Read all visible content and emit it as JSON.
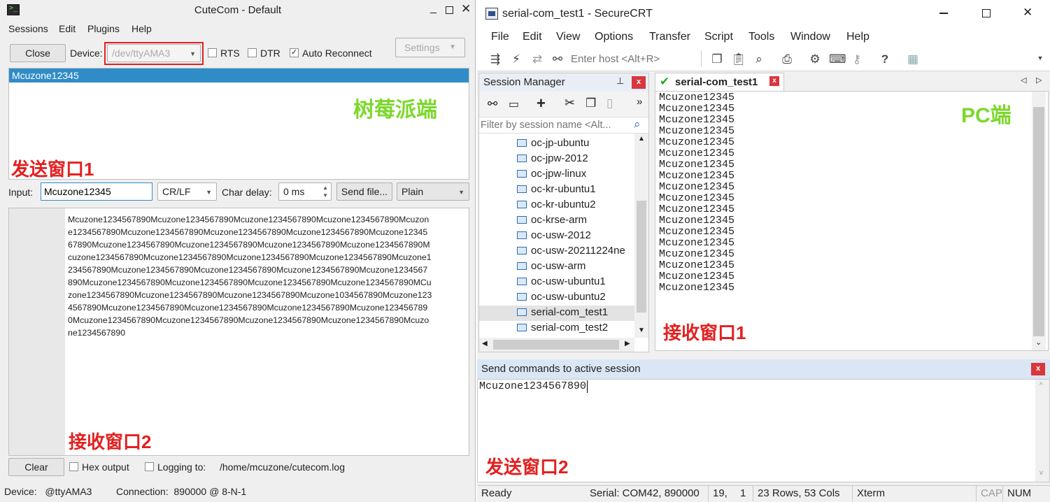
{
  "cutecom": {
    "title": "CuteCom - Default",
    "menu": [
      "Sessions",
      "Edit",
      "Plugins",
      "Help"
    ],
    "close_label": "Close",
    "device_label": "Device:",
    "device_value": "/dev/ttyAMA3",
    "rts_label": "RTS",
    "rts_checked": false,
    "dtr_label": "DTR",
    "dtr_checked": false,
    "auto_reconnect_label": "Auto Reconnect",
    "auto_reconnect_checked": true,
    "settings_label": "Settings",
    "history_items": [
      "Mcuzone12345"
    ],
    "annotation_side": "树莓派端",
    "annotation_send": "发送窗口1",
    "input_label": "Input:",
    "input_value": "Mcuzone12345",
    "line_ending": "CR/LF",
    "char_delay_label": "Char delay:",
    "char_delay_value": "0 ms",
    "send_file_label": "Send file...",
    "format_value": "Plain",
    "received_lines": [
      "Mcuzone1234567890Mcuzone1234567890Mcuzone1234567890Mcuzone1234567890Mcuzon",
      "e1234567890Mcuzone1234567890Mcuzone1234567890Mcuzone1234567890Mcuzone12345",
      "67890Mcuzone1234567890Mcuzone1234567890Mcuzone1234567890Mcuzone1234567890M",
      "cuzone1234567890Mcuzone1234567890Mcuzone1234567890Mcuzone1234567890Mcuzone1",
      "234567890Mcuzone1234567890Mcuzone1234567890Mcuzone1234567890Mcuzone1234567",
      "890Mcuzone1234567890Mcuzone1234567890Mcuzone1234567890Mcuzone1234567890MCu",
      "zone1234567890Mcuzone1234567890Mcuzone1234567890Mcuzone1034567890Mcuzone123",
      "4567890Mcuzone1234567890Mcuzone1234567890Mcuzone1234567890Mcuzone123456789",
      "0Mcuzone1234567890Mcuzone1234567890Mcuzone1234567890Mcuzone1234567890Mcuzo",
      "ne1234567890"
    ],
    "annotation_receive": "接收窗口2",
    "clear_label": "Clear",
    "hex_output_label": "Hex output",
    "hex_output_checked": false,
    "logging_label": "Logging to:",
    "logging_checked": false,
    "log_path": "/home/mcuzone/cutecom.log",
    "status_device": "Device:   @ttyAMA3",
    "status_connection": "Connection:  890000 @ 8-N-1"
  },
  "securecrt": {
    "title": "serial-com_test1 - SecureCRT",
    "menu": [
      "File",
      "Edit",
      "View",
      "Options",
      "Transfer",
      "Script",
      "Tools",
      "Window",
      "Help"
    ],
    "host_placeholder": "Enter host <Alt+R>",
    "session_manager_title": "Session Manager",
    "filter_placeholder": "Filter by session name <Alt...",
    "sessions": [
      "oc-jp-ubuntu",
      "oc-jpw-2012",
      "oc-jpw-linux",
      "oc-kr-ubuntu1",
      "oc-kr-ubuntu2",
      "oc-krse-arm",
      "oc-usw-2012",
      "oc-usw-20211224ne",
      "oc-usw-arm",
      "oc-usw-ubuntu1",
      "oc-usw-ubuntu2",
      "serial-com_test1",
      "serial-com_test2"
    ],
    "selected_session": "serial-com_test1",
    "tab_label": "serial-com_test1",
    "terminal_lines": [
      "Mcuzone12345",
      "Mcuzone12345",
      "Mcuzone12345",
      "Mcuzone12345",
      "Mcuzone12345",
      "Mcuzone12345",
      "Mcuzone12345",
      "Mcuzone12345",
      "Mcuzone12345",
      "Mcuzone12345",
      "Mcuzone12345",
      "Mcuzone12345",
      "Mcuzone12345",
      "Mcuzone12345",
      "Mcuzone12345",
      "Mcuzone12345",
      "Mcuzone12345",
      "Mcuzone12345"
    ],
    "annotation_pc": "PC端",
    "annotation_receive": "接收窗口1",
    "send_commands_title": "Send commands to active session",
    "command_text": "Mcuzone1234567890",
    "annotation_send": "发送窗口2",
    "status_ready": "Ready",
    "status_serial": "Serial: COM42, 890000",
    "status_pos_row": "19,",
    "status_pos_col": "1",
    "status_size": "23 Rows, 53 Cols",
    "status_term": "Xterm",
    "status_cap": "CAP",
    "status_num": "NUM"
  },
  "colors": {
    "selection_blue": "#308cc6",
    "annotation_green": "#7cd82c",
    "annotation_red": "#e32020",
    "highlight_red_border": "#e32020",
    "close_red": "#d9363e",
    "check_green": "#22aa22"
  }
}
